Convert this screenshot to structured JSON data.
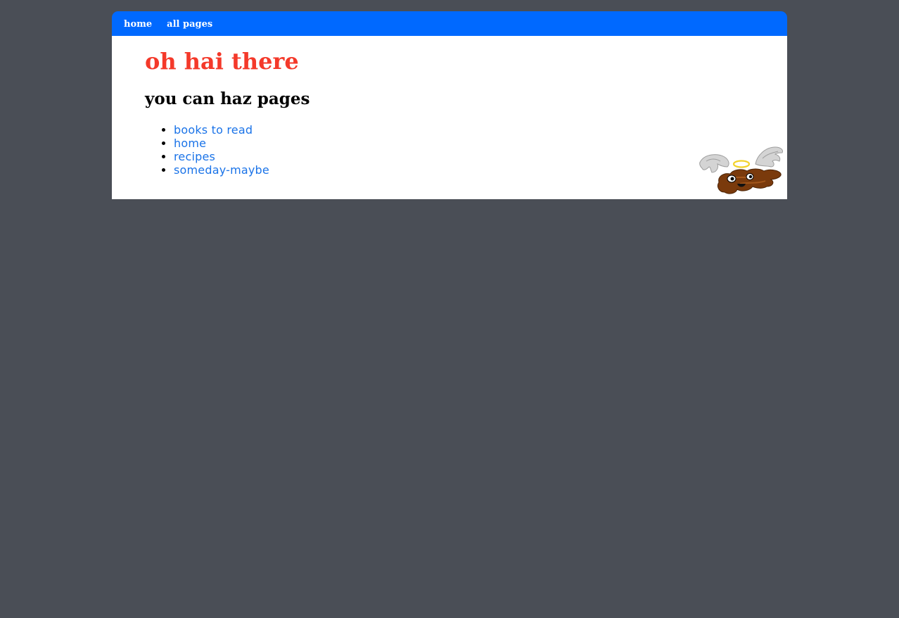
{
  "nav": {
    "items": [
      {
        "label": "home"
      },
      {
        "label": "all pages"
      }
    ]
  },
  "main": {
    "title": "oh hai there",
    "heading": "you can haz pages",
    "pages": [
      {
        "label": "books to read"
      },
      {
        "label": "home"
      },
      {
        "label": "recipes"
      },
      {
        "label": "someday-maybe"
      }
    ]
  },
  "mascot": {
    "icon": "winged-angel-poop-icon"
  },
  "colors": {
    "background": "#4a4e56",
    "navbar": "#0069ff",
    "title": "#f4392a",
    "link": "#1a73e8"
  }
}
